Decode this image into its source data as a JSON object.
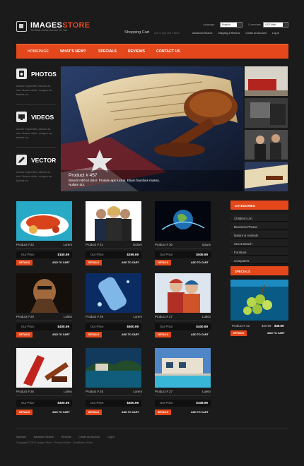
{
  "brand": {
    "title_a": "IMAGES",
    "title_b": "STORE",
    "tagline": "The Best Online Service For You"
  },
  "top": {
    "language_label": "Language:",
    "language_value": "English",
    "currencies_label": "Currencies:",
    "currency_value": "US Dollar",
    "cart_label": "Shopping Cart",
    "cart_sub": "now in your cart 0 items",
    "links": [
      "Advanced Search",
      "Shipping & Returns",
      "Create an Account",
      "Log In"
    ]
  },
  "nav": [
    "HOMEPAGE",
    "WHAT'S NEW?",
    "SPECIALS",
    "REVIEWS",
    "CONTACT US"
  ],
  "sidebar": {
    "text": "Auctor imperdiet, dictum at, nisi. Nosce dolor, congue eu, lacinia eu.",
    "sections": [
      {
        "title": "PHOTOS",
        "icon": "camera-icon"
      },
      {
        "title": "VIDEOS",
        "icon": "monitor-icon"
      },
      {
        "title": "VECTOR",
        "icon": "pen-icon"
      }
    ]
  },
  "hero": {
    "title": "Product # 457",
    "text": "Blandit nibh id dolor. Proside aps luctus. Etiam faucibus massa. Nullam dui."
  },
  "products": [
    {
      "name": "Product # 32",
      "brand": "Lorem",
      "price_label": "Our Price",
      "price": "$150.99"
    },
    {
      "name": "Product # 31",
      "brand": "Dolore",
      "price_label": "Our Price",
      "price": "$299.99"
    },
    {
      "name": "Product # 30",
      "brand": "Ipsum",
      "price_label": "Our Price",
      "price": "$509.99"
    },
    {
      "name": "Product # 29",
      "brand": "Luleto",
      "price_label": "Our Price",
      "price": "$400.99"
    },
    {
      "name": "Product # 28",
      "brand": "Lorem",
      "price_label": "Our Price",
      "price": "$600.99"
    },
    {
      "name": "Product # 27",
      "brand": "Luleto",
      "price_label": "Our Price",
      "price": "$400.99"
    },
    {
      "name": "Product # 26",
      "brand": "Luleto",
      "price_label": "Our Price",
      "price": "$400.99"
    },
    {
      "name": "Product # 25",
      "brand": "Lorem",
      "price_label": "Our Price",
      "price": "$400.99"
    },
    {
      "name": "Product # 27",
      "brand": "Luleto",
      "price_label": "Our Price",
      "price": "$408.99"
    }
  ],
  "buttons": {
    "details": "DETAILS",
    "add_to_cart": "ADD TO CART"
  },
  "categories": {
    "heading": "CATEGORIES",
    "items": [
      "Children's Art",
      "Business Photos",
      "Nature & Animals",
      "Sea & Beach",
      "Furniture",
      "Computers"
    ]
  },
  "specials": {
    "heading": "SPECIALS",
    "product": "Product # 42",
    "old_price": "$29.99",
    "new_price": "$49.99",
    "details": "DETAILS",
    "add_to_cart": "ADD TO CART"
  },
  "footer": {
    "links": [
      "Specials",
      "Advanced Search",
      "Reviews",
      "Create an Account",
      "Log In"
    ],
    "copy": "Copyright © 2010 Images Store",
    "privacy": "Privacy Notice",
    "conditions": "Conditions of Use"
  }
}
